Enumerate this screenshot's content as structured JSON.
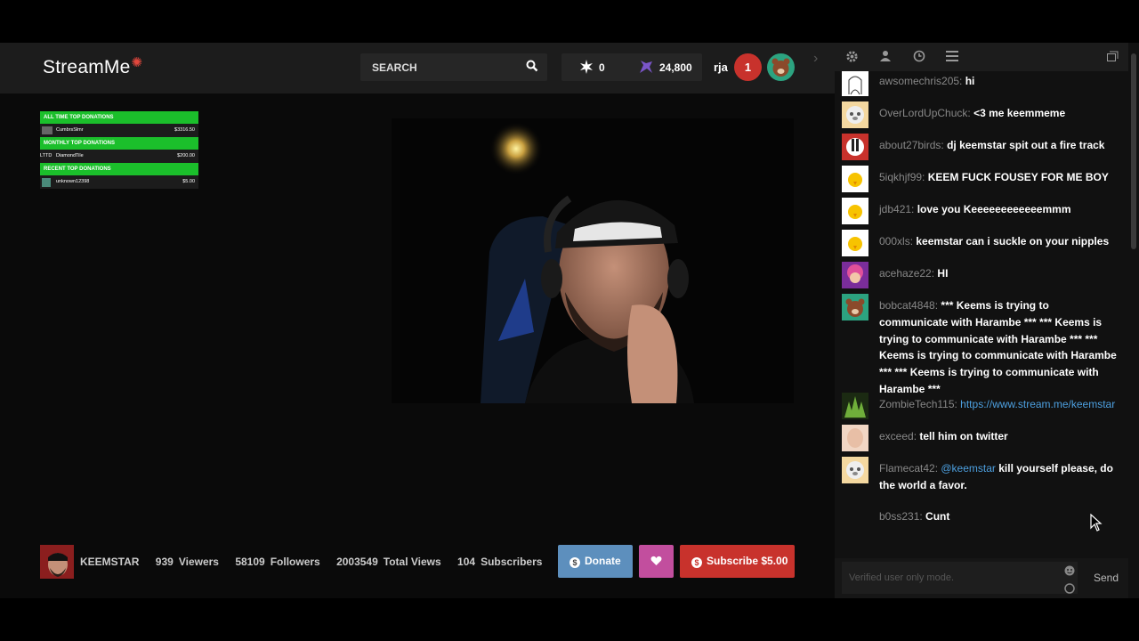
{
  "header": {
    "logo_text": "Stream",
    "logo_me": "Me",
    "search_label": "SEARCH",
    "sparks_count": "0",
    "unicorn_count": "24,800",
    "username": "rja",
    "notification_count": "1"
  },
  "overlay": {
    "all_time_title": "ALL TIME TOP DONATIONS",
    "all_time_name": "CumbrsSlmr",
    "all_time_value": "$3316.50",
    "monthly_title": "MONTHLY TOP DONATIONS",
    "monthly_prefix": "LTTD",
    "monthly_name": "DiamondTile",
    "monthly_value": "$200.00",
    "recent_title": "RECENT TOP DONATIONS",
    "recent_name": "unknown12398",
    "recent_value": "$5.00"
  },
  "footer": {
    "channel": "KEEMSTAR",
    "viewers_count": "939",
    "viewers_label": "Viewers",
    "followers_count": "58109",
    "followers_label": "Followers",
    "views_count": "2003549",
    "views_label": "Total Views",
    "subs_count": "104",
    "subs_label": "Subscribers",
    "donate_label": "Donate",
    "subscribe_label": "Subscribe $5.00"
  },
  "chat": {
    "messages": [
      {
        "user": "awsomechris205:",
        "text": "hi"
      },
      {
        "user": "OverLordUpChuck:",
        "text": "<3 me keemmeme"
      },
      {
        "user": "about27birds:",
        "text": "dj keemstar spit out a fire track"
      },
      {
        "user": "5iqkhjf99:",
        "text": "KEEM FUCK FOUSEY FOR ME BOY"
      },
      {
        "user": "jdb421:",
        "text": "love you Keeeeeeeeeeeemmm"
      },
      {
        "user": "000xls:",
        "text": "keemstar can i suckle on your nipples"
      },
      {
        "user": "acehaze22:",
        "text": "HI"
      },
      {
        "user": "bobcat4848:",
        "text": "*** Keems is trying to communicate with Harambe *** *** Keems is trying to communicate with Harambe *** *** Keems is trying to communicate with Harambe *** *** Keems is trying to communicate with Harambe ***"
      },
      {
        "user": "ZombieTech115:",
        "link": "https://www.stream.me/keemstar"
      },
      {
        "user": "exceed:",
        "text": "tell him on twitter"
      },
      {
        "user": "Flamecat42:",
        "mention": "@keemstar",
        "text": "kill yourself please, do the world a favor."
      },
      {
        "user": "b0ss231:",
        "text": "Cunt"
      }
    ],
    "input_placeholder": "Verified user only mode.",
    "send_label": "Send"
  },
  "colors": {
    "accent_red": "#c8322c",
    "donate_blue": "#5d8fbd",
    "heart_pink": "#c24e9e",
    "overlay_green": "#1bbf2b",
    "link_blue": "#4da0e0"
  }
}
